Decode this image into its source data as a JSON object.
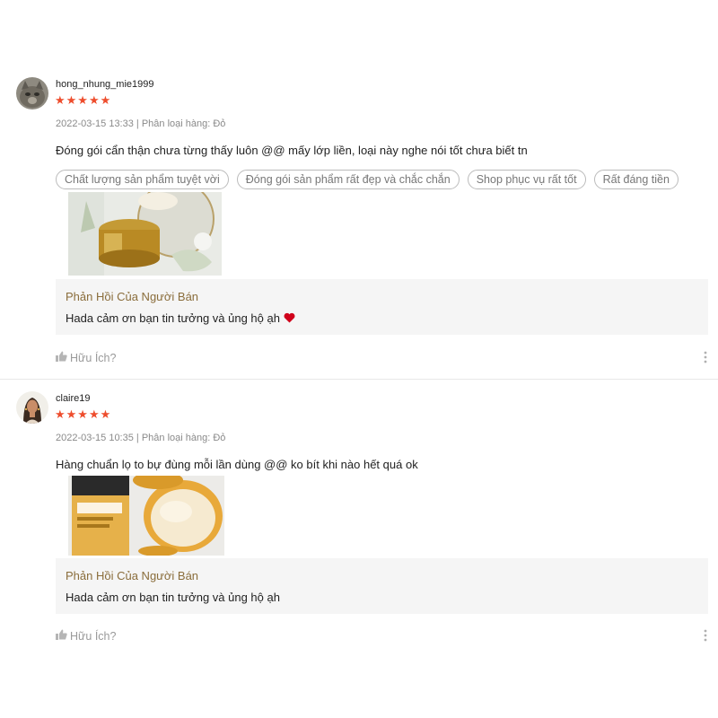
{
  "reviews": [
    {
      "username": "hong_nhung_mie1999",
      "stars": "★★★★★",
      "rating": 5,
      "date": "2022-03-15 13:33",
      "variation": "Phân loại hàng: Đỏ",
      "comment": "Đóng gói cẩn thận chưa từng thấy luôn @@ mấy lớp liền, loại này nghe nói tốt chưa biết tn",
      "tags": [
        "Chất lượng sản phẩm tuyệt vời",
        "Đóng gói sản phẩm rất đẹp và chắc chắn",
        "Shop phục vụ rất tốt",
        "Rất đáng tiền"
      ],
      "reply_title": "Phản Hồi Của Người Bán",
      "reply_text": "Hada cảm ơn bạn tin tưởng và ủng hộ ạh",
      "helpful_label": "Hữu Ích?"
    },
    {
      "username": "claire19",
      "stars": "★★★★★",
      "rating": 5,
      "date": "2022-03-15 10:35",
      "variation": "Phân loại hàng: Đỏ",
      "comment": "Hàng chuẩn lọ to bự đùng mỗi lần dùng @@ ko bít khi nào hết quá ok",
      "reply_title": "Phản Hồi Của Người Bán",
      "reply_text": "Hada cảm ơn bạn tin tưởng và ủng hộ ạh",
      "helpful_label": "Hữu Ích?"
    }
  ],
  "colors": {
    "star": "#ee4d2d",
    "reply_title": "#8a6d3b",
    "reply_bg": "#f5f5f5",
    "heart": "#d0021b"
  },
  "icons": [
    "thumbs-up-icon",
    "more-vertical-icon",
    "heart-icon",
    "star-icon"
  ]
}
